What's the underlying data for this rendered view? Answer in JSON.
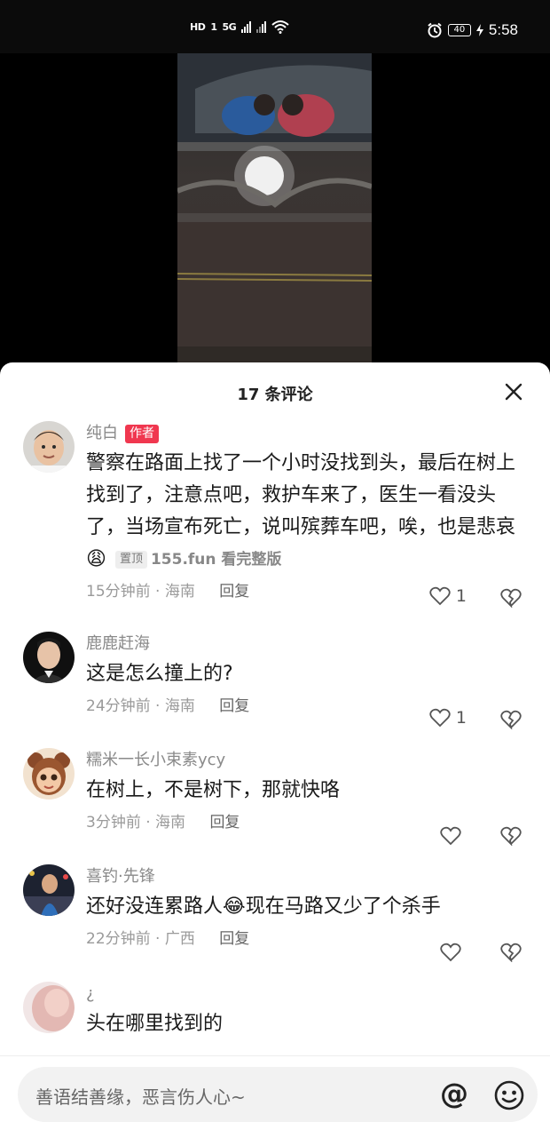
{
  "statusbar": {
    "hd_label": "HD",
    "sim_label": "1",
    "net_label": "5G",
    "battery": "40",
    "time": "5:58"
  },
  "sheet": {
    "title": "17 条评论"
  },
  "comments": [
    {
      "username": "纯白",
      "author_badge": "作者",
      "text": "警察在路面上找了一个小时没找到头，最后在树上找到了，注意点吧，救护车来了，医生一看没头了，当场宣布死亡，说叫殡葬车吧，唉，也是悲哀😩",
      "pinned_label": "置顶",
      "watermark": "155.fun 看完整版",
      "time_location": "15分钟前 · 海南",
      "reply_label": "回复",
      "likes": "1"
    },
    {
      "username": "鹿鹿赶海",
      "text": "这是怎么撞上的?",
      "time_location": "24分钟前 · 海南",
      "reply_label": "回复",
      "likes": "1"
    },
    {
      "username": "糯米一长小束素ycy",
      "text": "在树上，不是树下，那就快咯",
      "time_location": "3分钟前 · 海南",
      "reply_label": "回复",
      "likes": ""
    },
    {
      "username": "喜钓·先锋",
      "text": "还好没连累路人😂现在马路又少了个杀手",
      "time_location": "22分钟前 · 广西",
      "reply_label": "回复",
      "likes": ""
    },
    {
      "username": "¿",
      "text": "头在哪里找到的",
      "time_location": "",
      "reply_label": "",
      "likes": ""
    }
  ],
  "input": {
    "placeholder": "善语结善缘，恶言伤人心~",
    "at_symbol": "@"
  },
  "icons": {
    "close": "close-icon",
    "like": "heart-icon",
    "dislike": "broken-heart-icon",
    "emoji": "smiley-icon"
  }
}
